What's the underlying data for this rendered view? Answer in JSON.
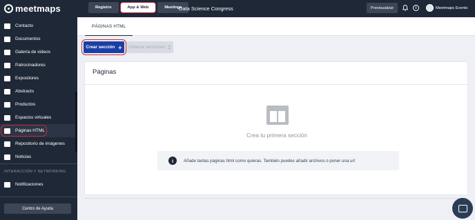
{
  "brand": {
    "name": "meetmaps"
  },
  "sidebar": {
    "items": [
      {
        "label": "Contacto",
        "icon": "phone-icon"
      },
      {
        "label": "Documentos",
        "icon": "paperclip-icon"
      },
      {
        "label": "Galería de videos",
        "icon": "video-icon"
      },
      {
        "label": "Patrocinadores",
        "icon": "flag-icon"
      },
      {
        "label": "Expositores",
        "icon": "store-icon"
      },
      {
        "label": "Abstracts",
        "icon": "book-icon"
      },
      {
        "label": "Productos",
        "icon": "box-icon"
      },
      {
        "label": "Espacios virtuales",
        "icon": "map-icon"
      },
      {
        "label": "Páginas HTML",
        "icon": "layout-icon",
        "active": true
      },
      {
        "label": "Repositorio de imágenes",
        "icon": "image-icon"
      },
      {
        "label": "Noticias",
        "icon": "news-icon"
      }
    ],
    "section_title": "INTERACCIÓN Y NETWORKING",
    "section_items": [
      {
        "label": "Notificaciones",
        "icon": "bell-icon"
      }
    ],
    "help_button": "Centro de Ayuda"
  },
  "topbar": {
    "tabs": [
      {
        "label": "Registro",
        "active": false
      },
      {
        "label": "App & Web",
        "active": true
      },
      {
        "label": "Meetings",
        "active": false
      }
    ],
    "event_name": "Data Science Congress",
    "preview_label": "Previsualizar",
    "user_name": "Meetmaps Events"
  },
  "content": {
    "subtab": "PÁGINAS HTML",
    "create_button": "Crear sección",
    "create_button_icon": "+",
    "order_button": "Ordenar secciones",
    "card_title": "Páginas",
    "empty_text": "Crea tu primera sección",
    "info_icon": "i",
    "info_text": "Añade tantas páginas html como quieras. También puedes añadir archivos o poner una url"
  },
  "colors": {
    "sidebar_bg": "#1f2837",
    "primary": "#1c3fa6",
    "highlight_ring": "#c4283a",
    "page_bg": "#eef0f5"
  }
}
